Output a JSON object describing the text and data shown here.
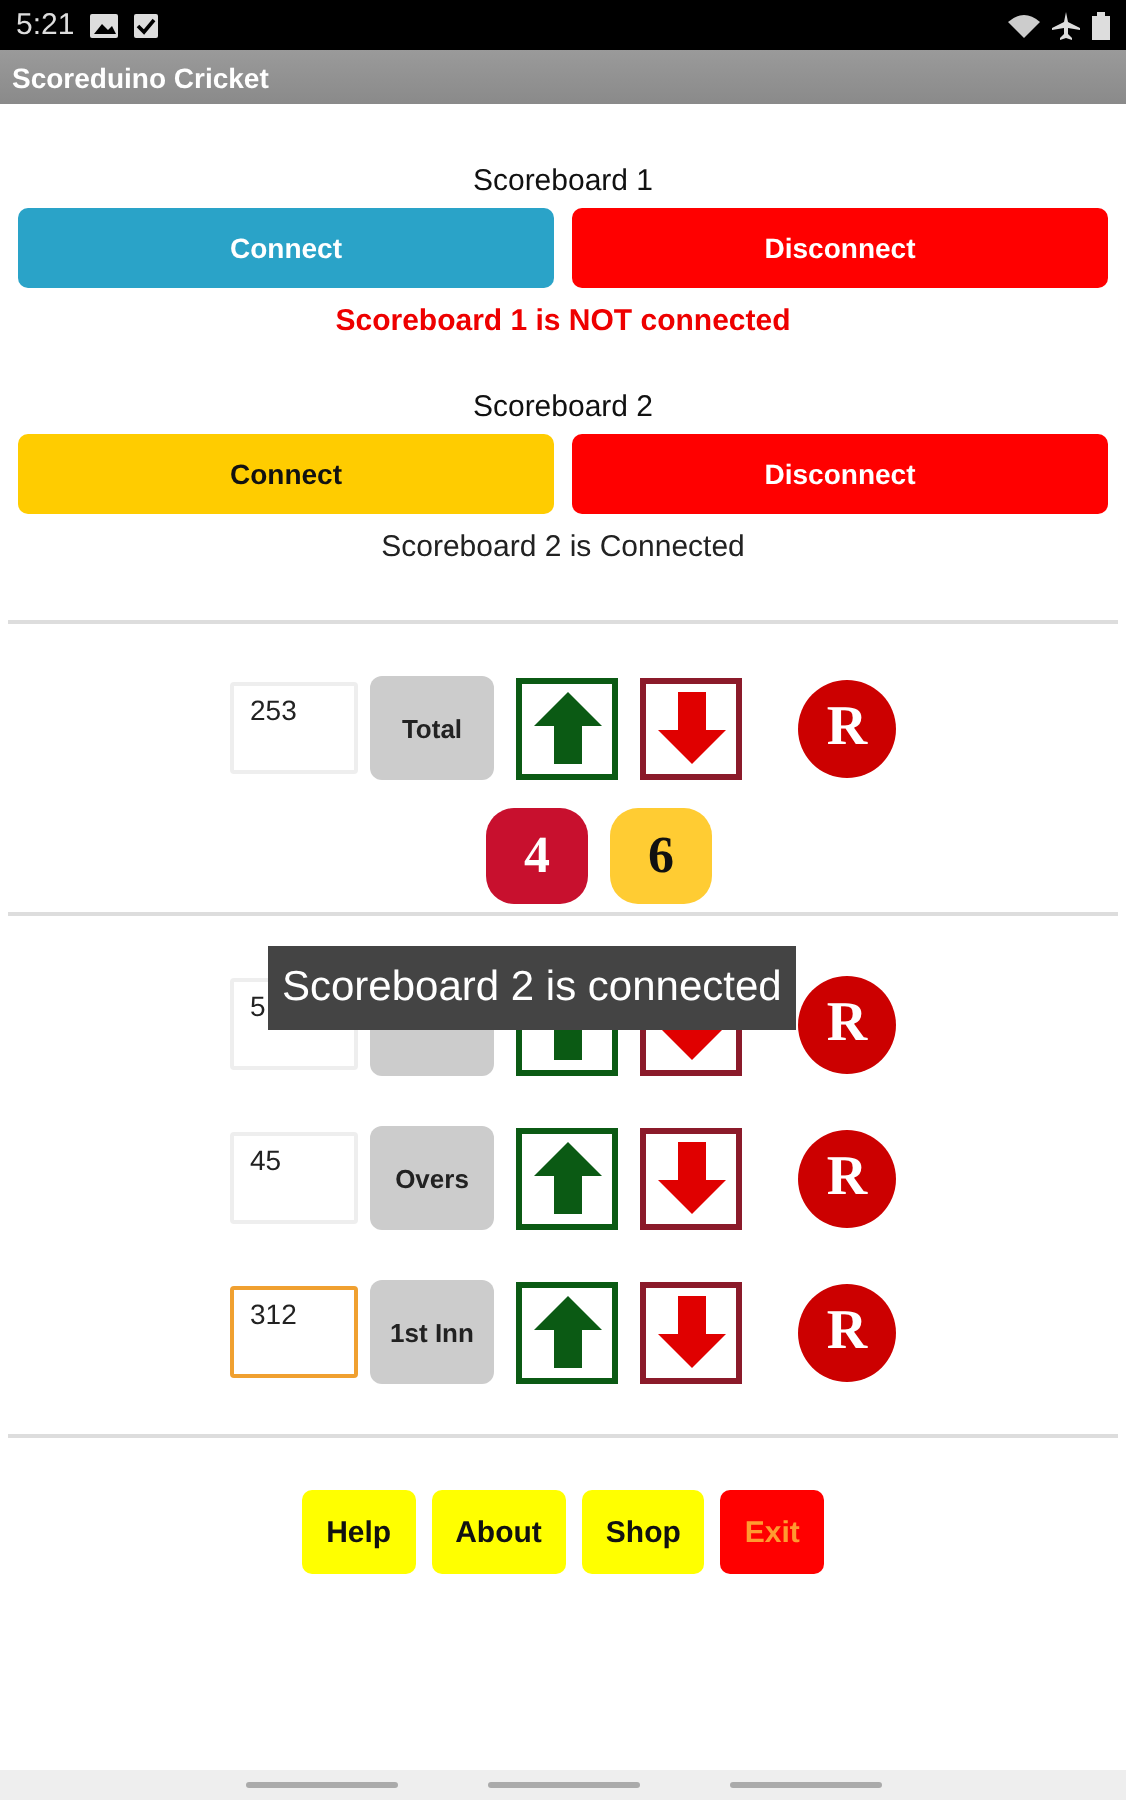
{
  "status_bar": {
    "time": "5:21"
  },
  "app_bar": {
    "title": "Scoreduino Cricket"
  },
  "scoreboards": [
    {
      "label": "Scoreboard 1",
      "connect": {
        "label": "Connect",
        "color": "#2aa3c8"
      },
      "disconnect": {
        "label": "Disconnect"
      },
      "status": "Scoreboard 1 is NOT connected",
      "connected": false
    },
    {
      "label": "Scoreboard 2",
      "connect": {
        "label": "Connect",
        "color": "#ffcc00"
      },
      "disconnect": {
        "label": "Disconnect"
      },
      "status": "Scoreboard 2 is Connected",
      "connected": true
    }
  ],
  "counters": [
    {
      "value": "253",
      "label": "Total",
      "reset": "R",
      "focused": false
    },
    {
      "value": "5",
      "reset": "R",
      "focused": false
    },
    {
      "value": "45",
      "label": "Overs",
      "reset": "R",
      "focused": false
    },
    {
      "value": "312",
      "label": "1st Inn",
      "reset": "R",
      "focused": true
    }
  ],
  "boundaries": [
    {
      "label": "4",
      "color": "#c8102e"
    },
    {
      "label": "6",
      "color": "#ffcc33"
    }
  ],
  "toast": "Scoreboard 2 is connected",
  "footer_buttons": [
    {
      "label": "Help",
      "kind": "normal"
    },
    {
      "label": "About",
      "kind": "normal"
    },
    {
      "label": "Shop",
      "kind": "normal"
    },
    {
      "label": "Exit",
      "kind": "exit"
    }
  ]
}
